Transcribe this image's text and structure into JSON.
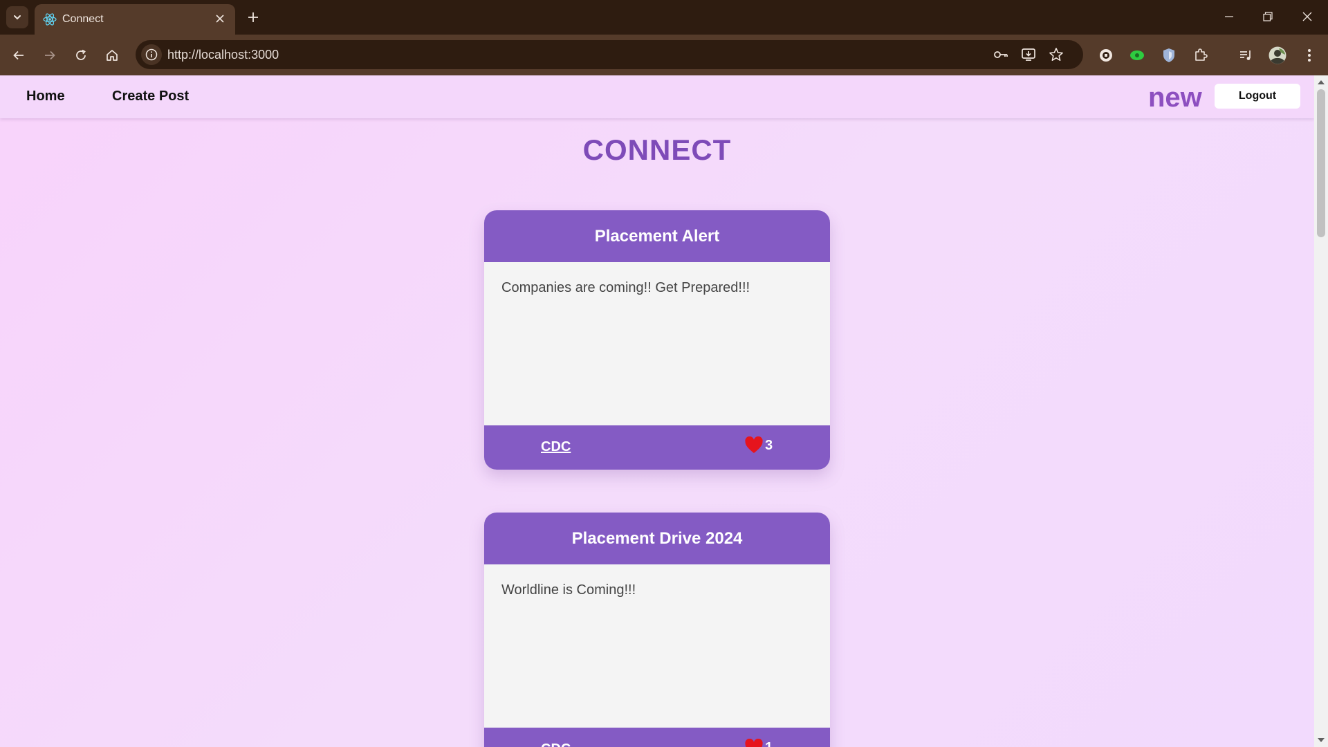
{
  "browser": {
    "tab": {
      "title": "Connect",
      "favicon": "react-icon"
    },
    "url": "http://localhost:3000",
    "icons": [
      "chevron-down-icon",
      "close-icon",
      "plus-icon",
      "minimize-icon",
      "restore-icon",
      "back-icon",
      "forward-icon",
      "reload-icon",
      "home-icon",
      "info-icon",
      "key-icon",
      "install-icon",
      "star-icon",
      "extension-icon",
      "puzzle-icon",
      "media-icon",
      "avatar",
      "kebab-menu-icon"
    ]
  },
  "nav": {
    "home": "Home",
    "create_post": "Create Post",
    "username": "new",
    "logout": "Logout"
  },
  "page": {
    "title": "CONNECT"
  },
  "posts": [
    {
      "title": "Placement Alert",
      "body": "Companies are coming!! Get Prepared!!!",
      "author": "CDC",
      "likes": "3"
    },
    {
      "title": "Placement Drive 2024",
      "body": "Worldline is Coming!!!",
      "author": "CDC",
      "likes": "1"
    }
  ],
  "colors": {
    "accent": "#845bc4",
    "title": "#7e4bb8",
    "heart": "#e6141d",
    "background": "#f4dcfb"
  }
}
